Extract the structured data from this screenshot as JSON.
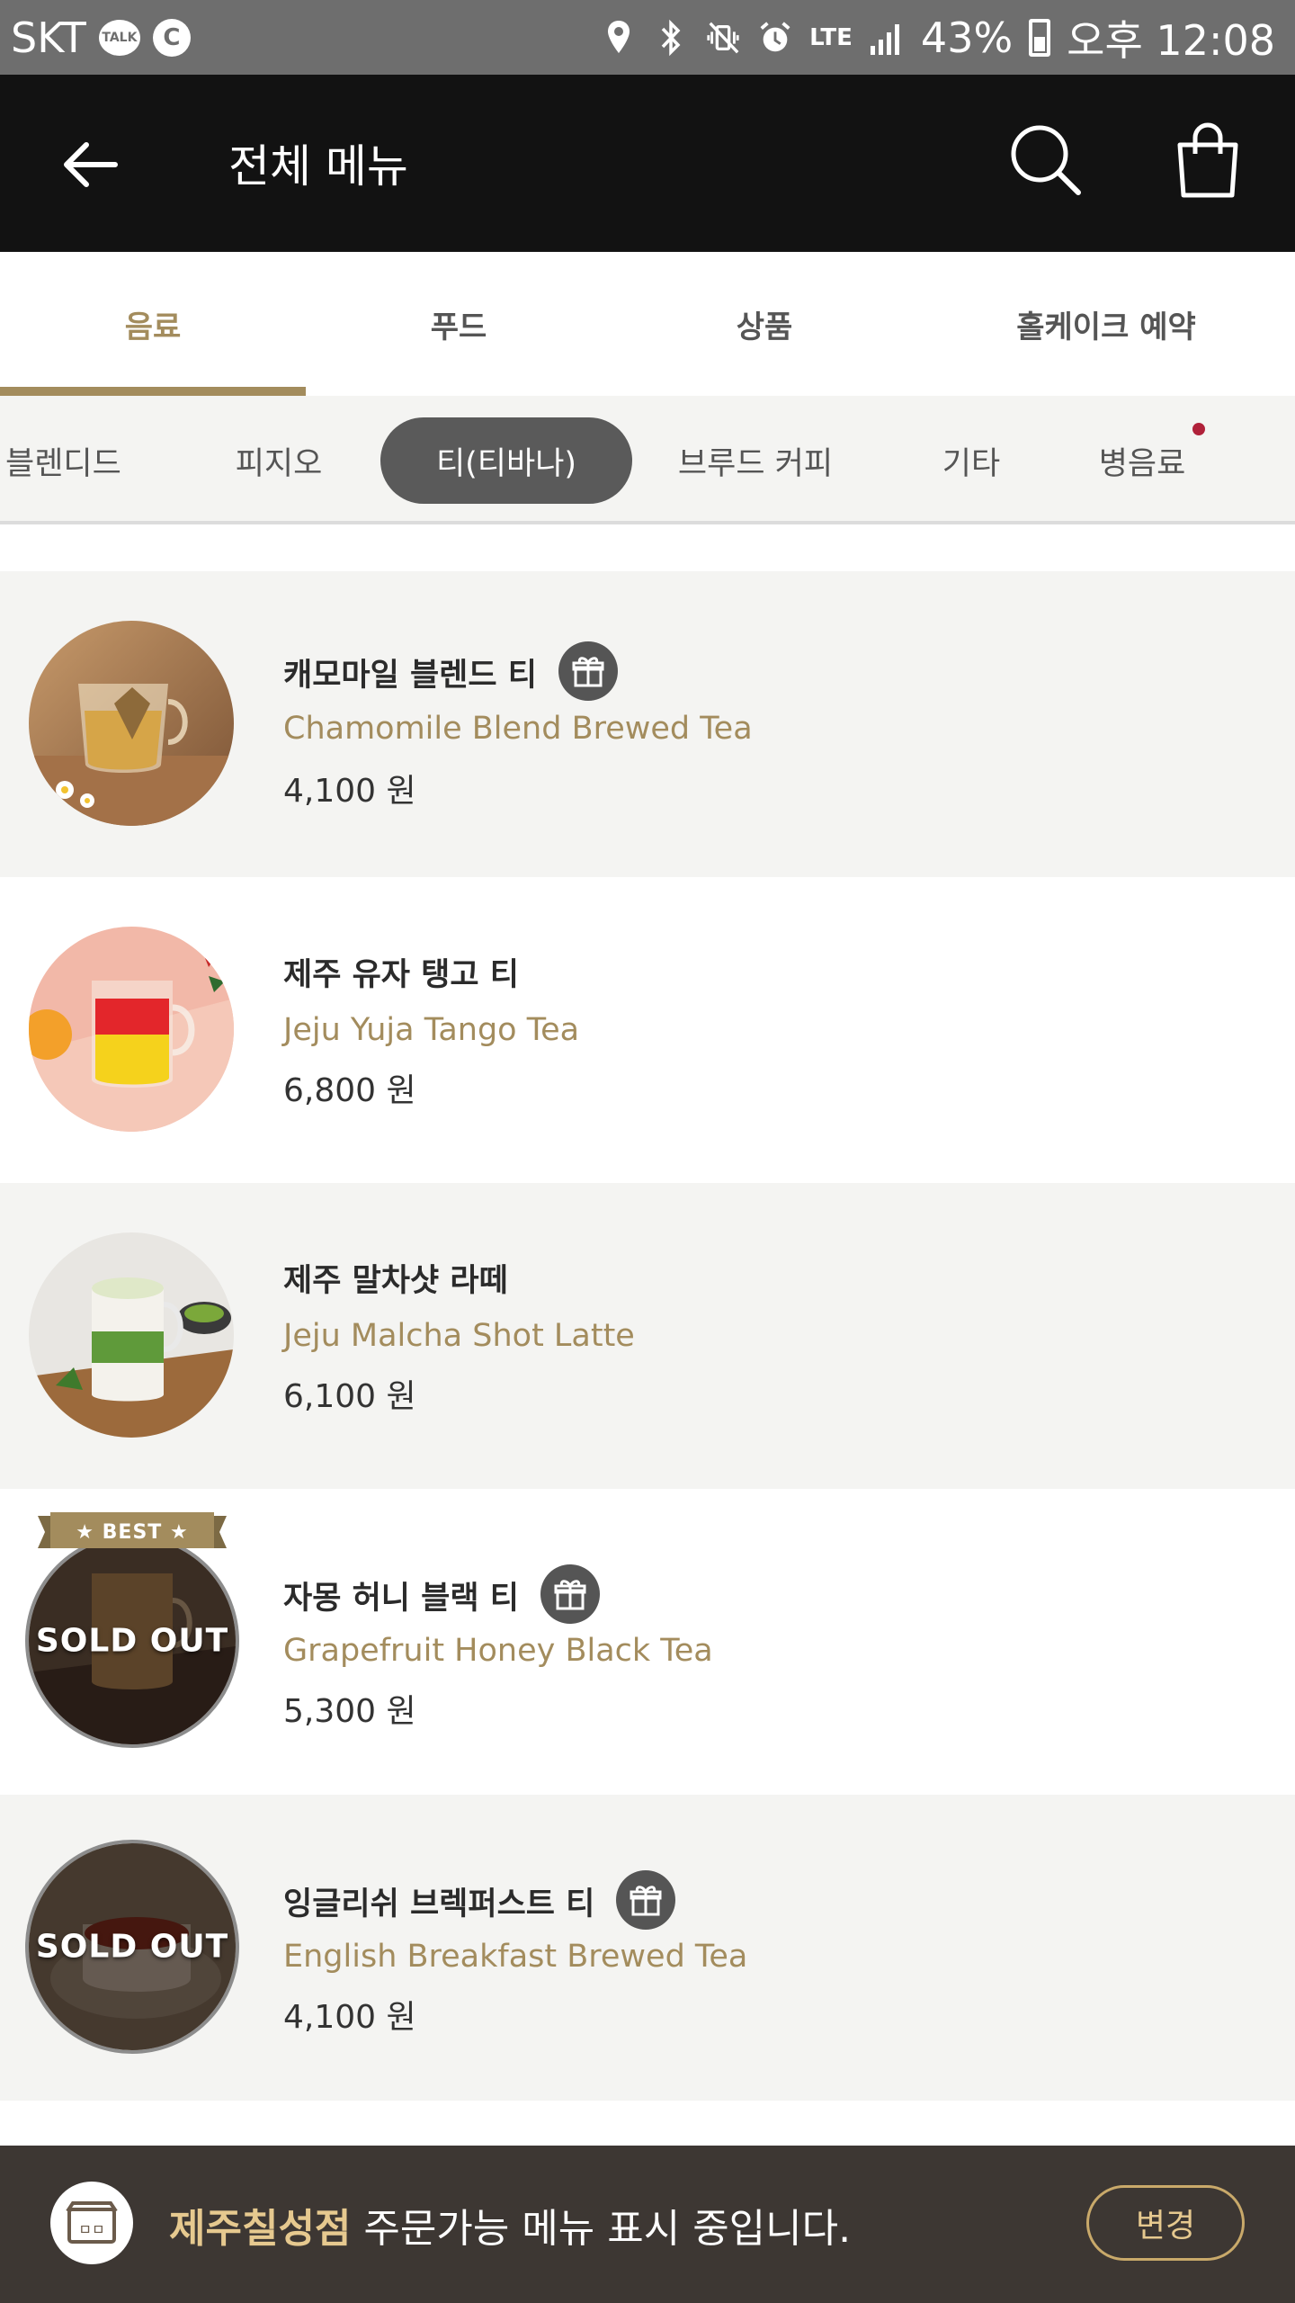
{
  "status_bar": {
    "carrier": "SKT",
    "talk_label": "TALK",
    "c_label": "C",
    "lte": "LTE",
    "battery": "43%",
    "time": "오후 12:08"
  },
  "header": {
    "title": "전체 메뉴"
  },
  "main_tabs": [
    {
      "label": "음료",
      "active": true
    },
    {
      "label": "푸드",
      "active": false
    },
    {
      "label": "상품",
      "active": false
    },
    {
      "label": "홀케이크 예약",
      "active": false
    }
  ],
  "sub_tabs": [
    {
      "label": "블렌디드",
      "active": false
    },
    {
      "label": "피지오",
      "active": false
    },
    {
      "label": "티(티바나)",
      "active": true
    },
    {
      "label": "브루드 커피",
      "active": false
    },
    {
      "label": "기타",
      "active": false
    },
    {
      "label": "병음료",
      "active": false,
      "new_dot": true
    }
  ],
  "menu_items": [
    {
      "name_ko": "캐모마일 블렌드 티",
      "name_en": "Chamomile Blend Brewed Tea",
      "price": "4,100 원",
      "gift": true,
      "sold_out": false,
      "best": false
    },
    {
      "name_ko": "제주 유자 탱고 티",
      "name_en": "Jeju Yuja Tango Tea",
      "price": "6,800 원",
      "gift": false,
      "sold_out": false,
      "best": false
    },
    {
      "name_ko": "제주 말차샷 라떼",
      "name_en": "Jeju Malcha Shot Latte",
      "price": "6,100 원",
      "gift": false,
      "sold_out": false,
      "best": false
    },
    {
      "name_ko": "자몽 허니 블랙 티",
      "name_en": "Grapefruit Honey Black Tea",
      "price": "5,300 원",
      "gift": true,
      "sold_out": true,
      "best": true
    },
    {
      "name_ko": "잉글리쉬 브렉퍼스트 티",
      "name_en": "English Breakfast Brewed Tea",
      "price": "4,100 원",
      "gift": true,
      "sold_out": true,
      "best": false
    }
  ],
  "labels": {
    "sold_out": "SOLD OUT",
    "best": "★ BEST ★"
  },
  "bottom_bar": {
    "store_name": "제주칠성점",
    "message": " 주문가능 메뉴 표시 중입니다.",
    "change_button": "변경",
    "store_icon_text": "ㅁㅁ"
  },
  "colors": {
    "accent": "#a38c5d",
    "header_bg": "#121212",
    "status_bg": "#6e6e6e",
    "bottom_bg": "#3d3733",
    "store_name": "#e6c98f",
    "new_dot": "#b0213a"
  }
}
